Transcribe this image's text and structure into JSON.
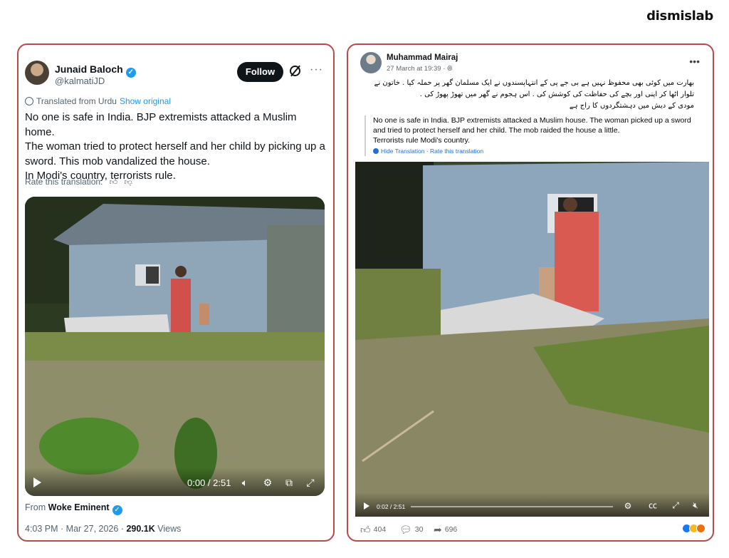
{
  "brand": "dismislab",
  "x_post": {
    "author_name": "Junaid Baloch",
    "handle": "@kalmatiJD",
    "follow_label": "Follow",
    "translated_label": "Translated from Urdu",
    "show_original_label": "Show original",
    "body_lines": [
      "No one is safe in India. BJP extremists attacked a Muslim home.",
      "The woman tried to protect herself and her child by picking up a",
      "sword. This mob vandalized the house.",
      "In Modi's country, terrorists rule."
    ],
    "rate_label": "Rate this translation:",
    "video_time": "0:00 / 2:51",
    "from_prefix": "From",
    "from_account": "Woke Eminent",
    "timestamp": "4:03 PM · Mar 27, 2026 ·",
    "views_count": "290.1K",
    "views_label": "Views",
    "icons": [
      "verified-badge-icon",
      "grok-icon",
      "more-icon",
      "globe-icon",
      "thumbs-up-icon",
      "thumbs-down-icon",
      "play-icon",
      "volume-icon",
      "settings-icon",
      "pip-icon",
      "fullscreen-icon"
    ]
  },
  "fb_post": {
    "author_name": "Muhammad Mairaj",
    "timestamp": "27 March at 19:39 ·",
    "urdu_lines": [
      "بھارت میں کوئی بھی محفوظ نہیں ہے بی جے پی کے انتہاپسندوں نے ایک مسلمان گھر پر حملہ کیا . خاتون نے",
      "تلوار اٹھا کر اپنی اور بچے کی حفاظت کی کوشش کی . اس ہجوم نے گھر میں تھوڑ پھوڑ کی .",
      "مودی کے دیش میں دہشتگردوں کا راج ہے"
    ],
    "translation_lines": [
      "No one is safe in India. BJP extremists attacked a Muslim house. The woman picked up a sword",
      "and tried to protect herself and her child. The mob raided the house a little.",
      "Terrorists rule Modi's country."
    ],
    "hide_translation_label": "Hide Translation",
    "rate_translation_label": "Rate this translation",
    "video_time": "0:02 / 2:51",
    "likes": "404",
    "comments": "30",
    "shares": "696",
    "icons": [
      "globe-icon",
      "more-icon",
      "play-icon",
      "settings-icon",
      "captions-icon",
      "fullscreen-icon",
      "volume-icon",
      "like-icon",
      "comment-icon",
      "share-icon"
    ]
  },
  "colors": {
    "card_border": "#b84a4a",
    "x_verified": "#1d9bf0",
    "fb_link": "#216fdb"
  }
}
